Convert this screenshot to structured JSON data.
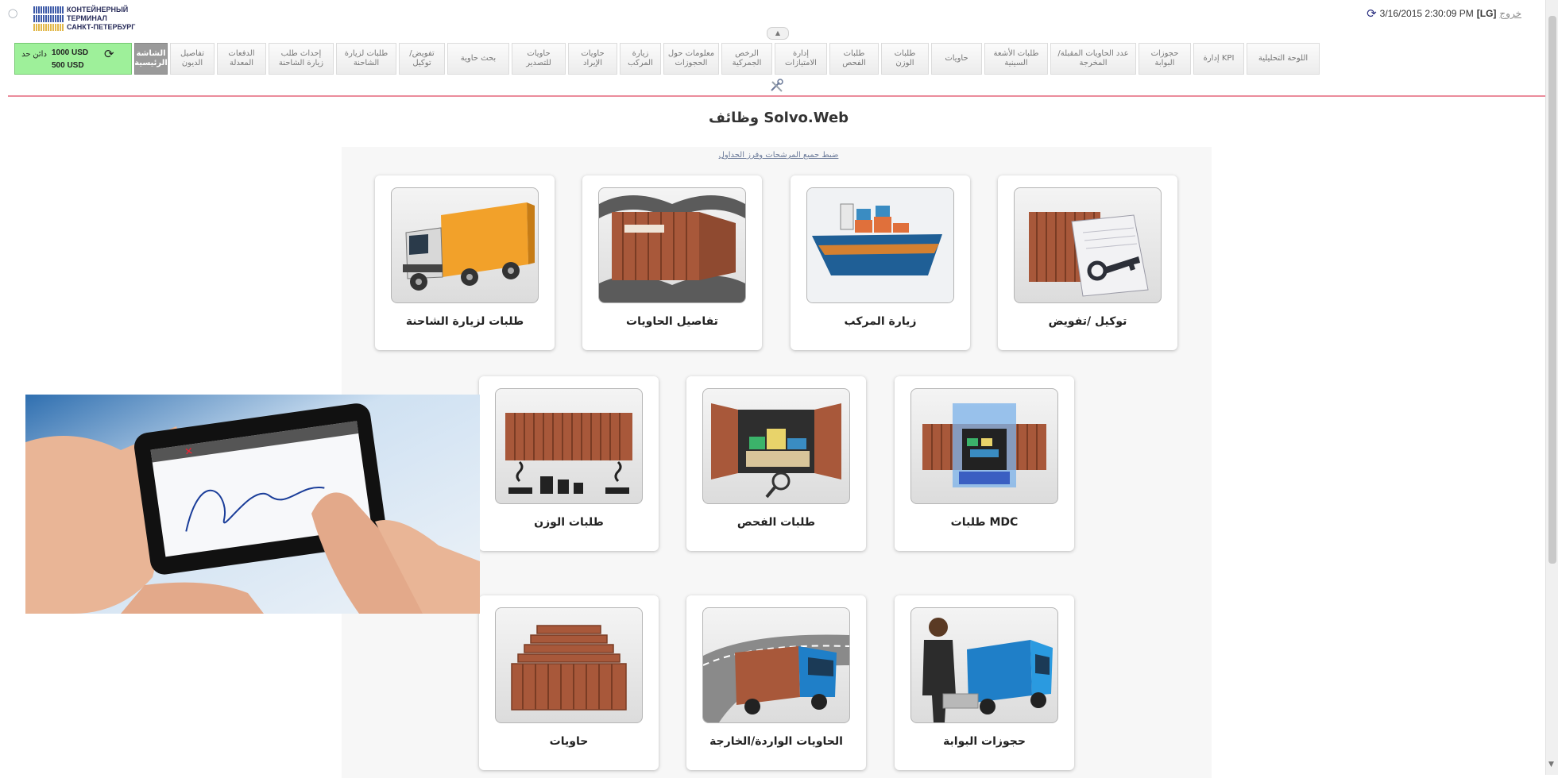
{
  "header": {
    "logo_lines": [
      "КОНТЕЙНЕРНЫЙ",
      "ТЕРМИНАЛ",
      "САНКТ-ПЕТЕРБУРГ"
    ],
    "datetime": "3/16/2015 2:30:09 PM",
    "user": "[LG]",
    "exit_label": "خروج"
  },
  "toolbar": {
    "balance": {
      "label": "دائن حد",
      "amount_1": "1000 USD",
      "amount_2": "500 USD"
    },
    "items": [
      {
        "label": "الشاشة الرئيسية",
        "active": true
      },
      {
        "label": "تفاصيل الديون"
      },
      {
        "label": "الدفعات المعدلة"
      },
      {
        "label": "إحداث طلب زيارة الشاحنة"
      },
      {
        "label": "طلبات لزيارة الشاحنة"
      },
      {
        "label": "/تفويض توكيل"
      },
      {
        "label": "بحث حاوية"
      },
      {
        "label": "حاويات للتصدير"
      },
      {
        "label": "حاويات الإيراد"
      },
      {
        "label": "زيارة المركب"
      },
      {
        "label": "معلومات حول الحجوزات"
      },
      {
        "label": "الرخص الجمركية"
      },
      {
        "label": "إدارة الامتيازات"
      },
      {
        "label": "طلبات الفحص"
      },
      {
        "label": "طلبات الوزن"
      },
      {
        "label": "حاويات"
      },
      {
        "label": "طلبات الأشعة السينية"
      },
      {
        "label": "عدد الحاويات المقبلة/المخرجة"
      },
      {
        "label": "حجوزات البوابة"
      },
      {
        "label": "إدارة KPI"
      },
      {
        "label": "اللوحة التحليلية"
      }
    ]
  },
  "main": {
    "title": "وظائف Solvo.Web",
    "reset_link": "ضبط جميع المرشحات وفرز الجداول",
    "tiles": [
      {
        "label": "توكيل /تفويض",
        "icon": "container-key-document-icon"
      },
      {
        "label": "زيارة المركب",
        "icon": "cargo-ship-icon"
      },
      {
        "label": "تفاصيل الحاويات",
        "icon": "container-detail-icon"
      },
      {
        "label": "طلبات لزيارة الشاحنة",
        "icon": "truck-icon"
      },
      {
        "label": "MDC طلبات",
        "icon": "container-scan-icon"
      },
      {
        "label": "طلبات الفحص",
        "icon": "container-inspection-icon"
      },
      {
        "label": "طلبات الوزن",
        "icon": "container-weights-icon"
      },
      {
        "label": "حجوزات البوابة",
        "icon": "gate-booking-icon"
      },
      {
        "label": "الحاويات الواردة/الخارجة",
        "icon": "truck-road-icon"
      },
      {
        "label": "حاويات",
        "icon": "stacked-containers-icon"
      }
    ]
  },
  "colors": {
    "accent_line": "#e25b72",
    "balance_bg": "#9ef09a",
    "container_brown": "#a8583a",
    "truck_blue": "#1f7fc8",
    "truck_orange": "#f2a12a"
  }
}
